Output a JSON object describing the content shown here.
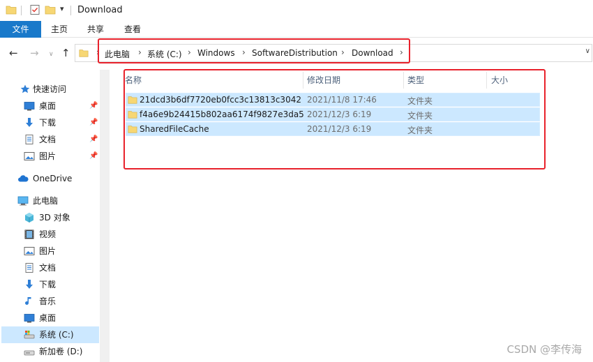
{
  "window": {
    "title": "Download"
  },
  "ribbon": {
    "tabs": [
      "文件",
      "主页",
      "共享",
      "查看"
    ]
  },
  "address": {
    "crumbs": [
      "此电脑",
      "系统 (C:)",
      "Windows",
      "SoftwareDistribution",
      "Download"
    ]
  },
  "sidebar": {
    "quick_access": {
      "label": "快速访问",
      "icon": "star-icon"
    },
    "pinned": [
      {
        "label": "桌面",
        "icon": "desktop-icon"
      },
      {
        "label": "下载",
        "icon": "download-icon"
      },
      {
        "label": "文档",
        "icon": "document-icon"
      },
      {
        "label": "图片",
        "icon": "picture-icon"
      }
    ],
    "onedrive": {
      "label": "OneDrive",
      "icon": "cloud-icon"
    },
    "this_pc": {
      "label": "此电脑",
      "icon": "computer-icon"
    },
    "pc_items": [
      {
        "label": "3D 对象",
        "icon": "cube-icon"
      },
      {
        "label": "视频",
        "icon": "video-icon"
      },
      {
        "label": "图片",
        "icon": "picture-icon"
      },
      {
        "label": "文档",
        "icon": "document-icon"
      },
      {
        "label": "下载",
        "icon": "download-icon"
      },
      {
        "label": "音乐",
        "icon": "music-icon"
      },
      {
        "label": "桌面",
        "icon": "desktop-icon"
      },
      {
        "label": "系统 (C:)",
        "icon": "drive-icon",
        "selected": true
      },
      {
        "label": "新加卷 (D:)",
        "icon": "drive-icon"
      }
    ]
  },
  "columns": {
    "name": "名称",
    "date": "修改日期",
    "type": "类型",
    "size": "大小"
  },
  "files": [
    {
      "name": "21dcd3b6df7720eb0fcc3c13813c3042",
      "date": "2021/11/8 17:46",
      "type": "文件夹",
      "size": ""
    },
    {
      "name": "f4a6e9b24415b802aa6174f9827e3da5",
      "date": "2021/12/3 6:19",
      "type": "文件夹",
      "size": ""
    },
    {
      "name": "SharedFileCache",
      "date": "2021/12/3 6:19",
      "type": "文件夹",
      "size": ""
    }
  ],
  "watermark": "CSDN @李传海",
  "colors": {
    "accent": "#1979ca",
    "selection": "#cce8ff",
    "highlight_box": "#e8212b",
    "folder": "#f7d774"
  }
}
